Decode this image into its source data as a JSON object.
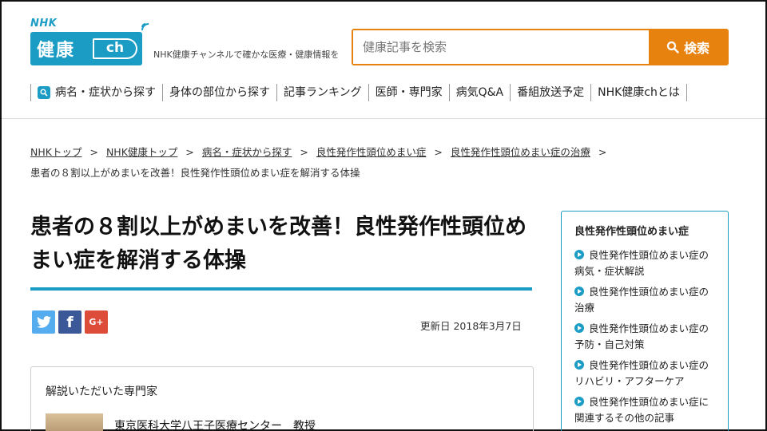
{
  "header": {
    "logo_nhk": "NHK",
    "logo_kanji": "健康",
    "logo_ch": "ch",
    "tagline": "NHK健康チャンネルで確かな医療・健康情報を",
    "search_placeholder": "健康記事を検索",
    "search_button": "検索"
  },
  "nav": {
    "items": [
      {
        "label": "病名・症状から探す"
      },
      {
        "label": "身体の部位から探す"
      },
      {
        "label": "記事ランキング"
      },
      {
        "label": "医師・専門家"
      },
      {
        "label": "病気Q&A"
      },
      {
        "label": "番組放送予定"
      },
      {
        "label": "NHK健康chとは"
      }
    ]
  },
  "breadcrumb": {
    "links": [
      {
        "label": "NHKトップ"
      },
      {
        "label": "NHK健康トップ"
      },
      {
        "label": "病名・症状から探す"
      },
      {
        "label": "良性発作性頭位めまい症"
      },
      {
        "label": "良性発作性頭位めまい症の治療"
      }
    ],
    "separator": ">",
    "current": "患者の８割以上がめまいを改善！良性発作性頭位めまい症を解消する体操"
  },
  "article": {
    "title": "患者の８割以上がめまいを改善！良性発作性頭位めまい症を解消する体操",
    "share": {
      "twitter": "t",
      "facebook": "f",
      "google": "G+"
    },
    "updated": "更新日 2018年3月7日",
    "expert_heading": "解説いただいた専門家",
    "expert_affiliation": "東京医科大学八王子医療センター　教授"
  },
  "sidebar": {
    "heading": "良性発作性頭位めまい症",
    "items": [
      {
        "label": "良性発作性頭位めまい症の病気・症状解説"
      },
      {
        "label": "良性発作性頭位めまい症の治療"
      },
      {
        "label": "良性発作性頭位めまい症の予防・自己対策"
      },
      {
        "label": "良性発作性頭位めまい症のリハビリ・アフターケア"
      },
      {
        "label": "良性発作性頭位めまい症に関連するその他の記事"
      }
    ]
  },
  "colors": {
    "brand": "#1b9cc4",
    "search_accent": "#e8820f"
  }
}
